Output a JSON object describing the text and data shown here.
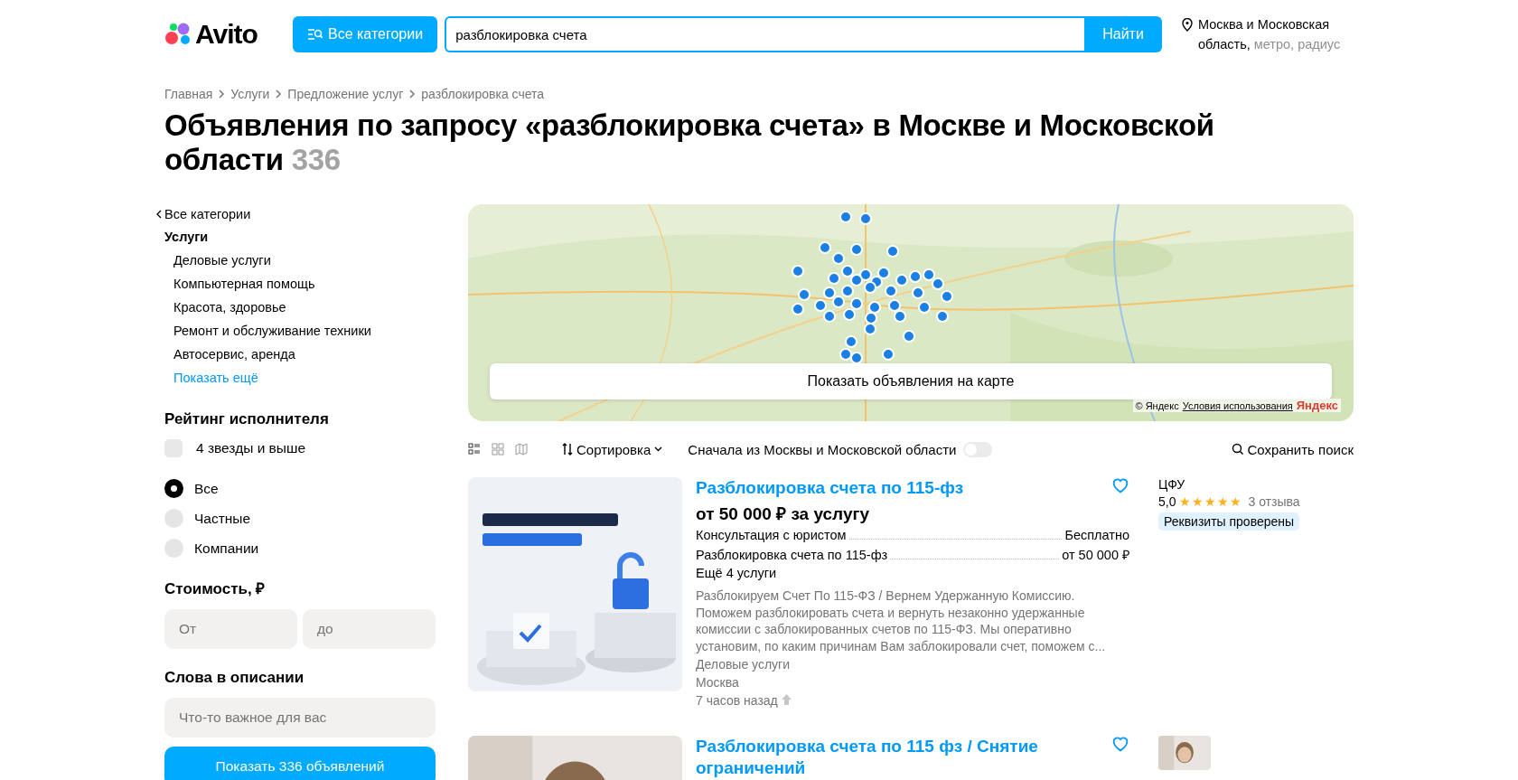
{
  "header": {
    "logo": "Avito",
    "category_button": "Все категории",
    "search": {
      "value": "разблокировка счета",
      "button": "Найти"
    },
    "location": "Москва и Московская область,",
    "location_options": [
      "метро,",
      "радиус"
    ]
  },
  "breadcrumbs": [
    "Главная",
    "Услуги",
    "Предложение услуг",
    "разблокировка счета"
  ],
  "title": "Объявления по запросу «разблокировка счета» в Москве и Московской области",
  "count": "336",
  "sidebar": {
    "back_link": "Все категории",
    "category": "Услуги",
    "subcategories": [
      "Деловые услуги",
      "Компьютерная помощь",
      "Красота, здоровье",
      "Ремонт и обслуживание техники",
      "Автосервис, аренда"
    ],
    "show_more": "Показать ещё",
    "rating": {
      "title": "Рейтинг исполнителя",
      "checkbox": {
        "label": "4 звезды и выше",
        "checked": false
      }
    },
    "seller_types": [
      {
        "label": "Все",
        "selected": true
      },
      {
        "label": "Частные",
        "selected": false
      },
      {
        "label": "Компании",
        "selected": false
      }
    ],
    "price": {
      "title": "Стоимость, ₽",
      "from_placeholder": "От",
      "to_placeholder": "до"
    },
    "words": {
      "title": "Слова в описании",
      "placeholder": "Что-то важное для вас"
    },
    "submit": "Показать 336 объявлений"
  },
  "map": {
    "show_button": "Показать объявления на карте",
    "attribution": "© Яндекс",
    "terms_link": "Условия использования",
    "logo": "Яндекс"
  },
  "toolbar": {
    "views": [
      {
        "kind": "list",
        "selected": true
      },
      {
        "kind": "grid",
        "selected": false
      },
      {
        "kind": "map",
        "selected": false
      }
    ],
    "sort": "Сортировка",
    "toggle": {
      "label": "Сначала из Москвы и Московской области",
      "on": false
    },
    "save_search": "Сохранить поиск"
  },
  "listings": [
    {
      "title": "Разблокировка счета по 115-фз",
      "favorite": false,
      "price": "от 50 000 ₽ за услугу",
      "services": [
        {
          "name": "Консультация с юристом",
          "price": "Бесплатно"
        },
        {
          "name": "Разблокировка счета по 115-фз",
          "price": "от 50 000 ₽"
        }
      ],
      "more": "Ещё 4 услуги",
      "description": "Разблокируем Счет По 115-ФЗ / Вернем Удержанную Комиссию. Поможем разблокировать счета и вернуть незаконно удержанные комиссии с заблокированных счетов по 115-ФЗ. Мы оперативно установим, по каким причинам Вам заблокировали счет, поможем с...",
      "category": "Деловые услуги",
      "location": "Москва",
      "time": "7 часов назад",
      "seller": {
        "name": "ЦФУ",
        "rating": "5,0",
        "stars": 5,
        "reviews": "3 отзыва",
        "badge": "Реквизиты проверены"
      }
    },
    {
      "title": "Разблокировка счета по 115 фз / Снятие ограничений",
      "favorite": false
    }
  ]
}
